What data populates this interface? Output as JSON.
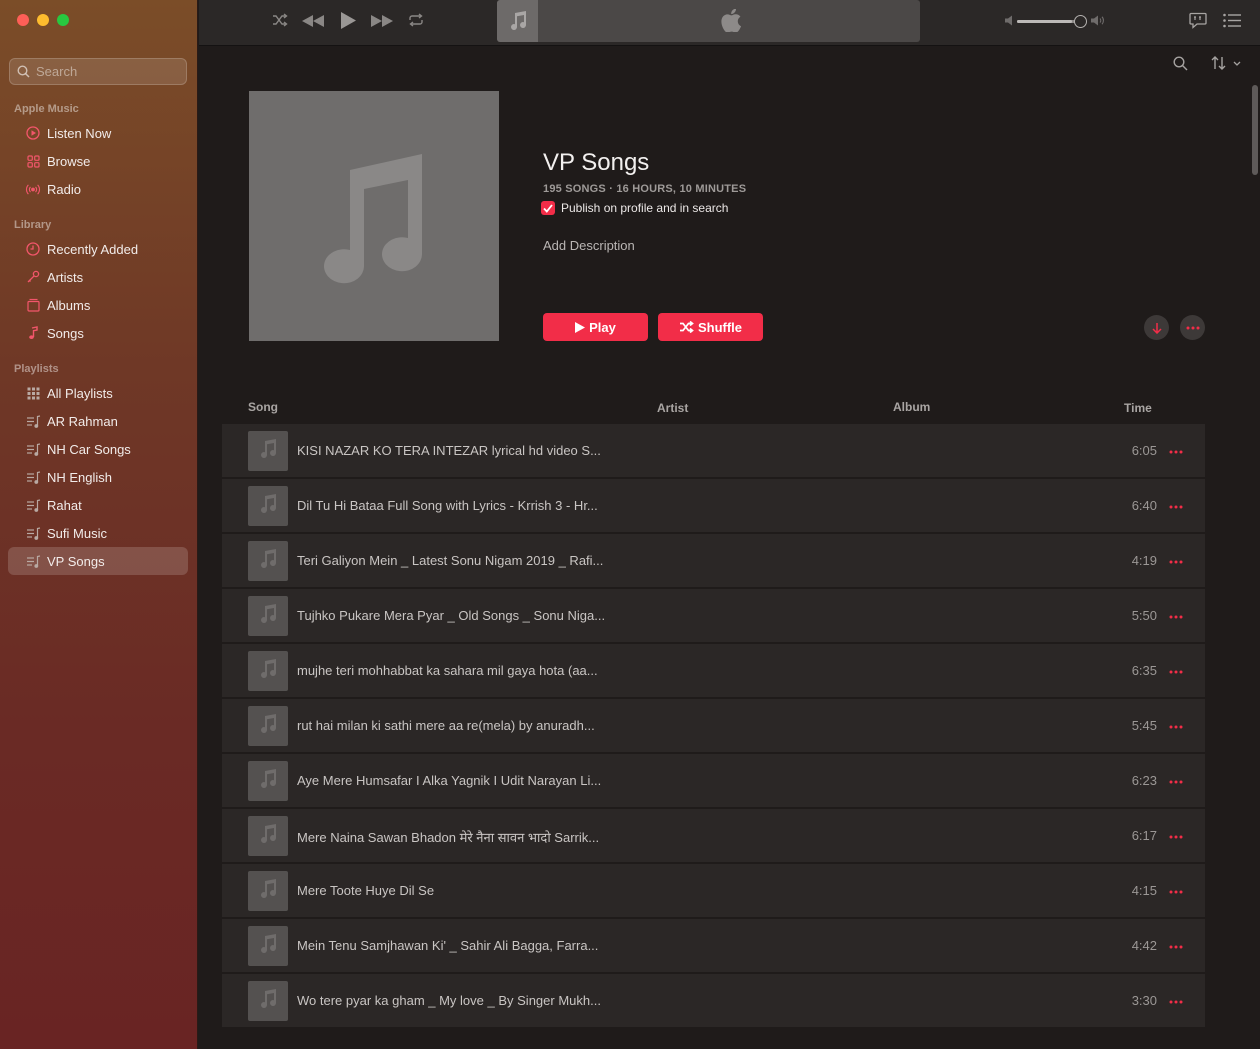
{
  "sidebar": {
    "search_placeholder": "Search",
    "sections": {
      "apple_music": "Apple Music",
      "library": "Library",
      "playlists": "Playlists"
    },
    "apple_music_items": [
      {
        "label": "Listen Now",
        "icon": "play-circle-icon"
      },
      {
        "label": "Browse",
        "icon": "grid-icon"
      },
      {
        "label": "Radio",
        "icon": "radio-icon"
      }
    ],
    "library_items": [
      {
        "label": "Recently Added",
        "icon": "clock-icon"
      },
      {
        "label": "Artists",
        "icon": "microphone-icon"
      },
      {
        "label": "Albums",
        "icon": "album-icon"
      },
      {
        "label": "Songs",
        "icon": "note-icon"
      }
    ],
    "playlist_items": [
      {
        "label": "All Playlists",
        "icon": "grid-dots-icon"
      },
      {
        "label": "AR Rahman",
        "icon": "playlist-icon"
      },
      {
        "label": "NH Car Songs",
        "icon": "playlist-icon"
      },
      {
        "label": "NH English",
        "icon": "playlist-icon"
      },
      {
        "label": "Rahat",
        "icon": "playlist-icon"
      },
      {
        "label": "Sufi Music",
        "icon": "playlist-icon"
      },
      {
        "label": "VP Songs",
        "icon": "playlist-icon",
        "selected": true
      }
    ]
  },
  "playlist": {
    "title": "VP Songs",
    "meta": "195 SONGS · 16 HOURS, 10 MINUTES",
    "publish_label": "Publish on profile and in search",
    "publish_checked": true,
    "add_description": "Add Description",
    "play_label": "Play",
    "shuffle_label": "Shuffle"
  },
  "columns": {
    "song": "Song",
    "artist": "Artist",
    "album": "Album",
    "time": "Time"
  },
  "songs": [
    {
      "title": "KISI NAZAR KO TERA INTEZAR lyrical hd video  S...",
      "time": "6:05"
    },
    {
      "title": "Dil Tu Hi Bataa Full Song with Lyrics - Krrish 3 - Hr...",
      "time": "6:40"
    },
    {
      "title": "Teri Galiyon Mein _ Latest Sonu Nigam 2019 _ Rafi...",
      "time": "4:19"
    },
    {
      "title": "Tujhko Pukare Mera Pyar _ Old Songs _ Sonu Niga...",
      "time": "5:50"
    },
    {
      "title": "mujhe teri mohhabbat ka sahara mil gaya hota (aa...",
      "time": "6:35"
    },
    {
      "title": "rut hai milan ki sathi mere aa re(mela) by anuradh...",
      "time": "5:45"
    },
    {
      "title": "Aye Mere Humsafar I Alka Yagnik I Udit Narayan Li...",
      "time": "6:23"
    },
    {
      "title": "Mere Naina Sawan Bhadon  मेरे नैना सावन भादो  Sarrik...",
      "time": "6:17"
    },
    {
      "title": "Mere Toote Huye Dil Se",
      "time": "4:15"
    },
    {
      "title": "Mein Tenu Samjhawan Ki' _ Sahir Ali Bagga, Farra...",
      "time": "4:42"
    },
    {
      "title": "Wo tere pyar ka gham _ My love _ By Singer Mukh...",
      "time": "3:30"
    }
  ],
  "colors": {
    "accent": "#f22d48",
    "sidebar_top": "#7b4d28",
    "sidebar_bottom": "#692423",
    "main_bg": "#1f1b1a",
    "row_bg": "#2b2726"
  },
  "volume_level": 0.85
}
